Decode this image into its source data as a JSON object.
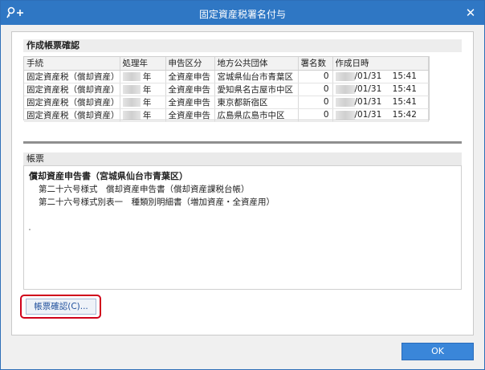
{
  "window": {
    "title": "固定資産税署名付与",
    "close_glyph": "✕",
    "app_icon": "key-plus-icon"
  },
  "section_confirm": {
    "header": "作成帳票確認"
  },
  "table": {
    "columns": [
      "手続",
      "処理年",
      "申告区分",
      "地方公共団体",
      "署名数",
      "作成日時"
    ],
    "rows": [
      {
        "procedure": "固定資産税（償却資産）",
        "year_suffix": "年",
        "category": "全資産申告",
        "municipality": "宮城県仙台市青葉区",
        "count": "0",
        "date": "/01/31",
        "time": "15:41"
      },
      {
        "procedure": "固定資産税（償却資産）",
        "year_suffix": "年",
        "category": "全資産申告",
        "municipality": "愛知県名古屋市中区",
        "count": "0",
        "date": "/01/31",
        "time": "15:41"
      },
      {
        "procedure": "固定資産税（償却資産）",
        "year_suffix": "年",
        "category": "全資産申告",
        "municipality": "東京都新宿区",
        "count": "0",
        "date": "/01/31",
        "time": "15:41"
      },
      {
        "procedure": "固定資産税（償却資産）",
        "year_suffix": "年",
        "category": "全資産申告",
        "municipality": "広島県広島市中区",
        "count": "0",
        "date": "/01/31",
        "time": "15:42"
      }
    ]
  },
  "section_report": {
    "header": "帳票",
    "main": "償却資産申告書（宮城県仙台市青葉区）",
    "items": [
      "第二十六号様式　償却資産申告書（償却資産課税台帳）",
      "第二十六号様式別表一　種類別明細書（増加資産・全資産用）"
    ]
  },
  "buttons": {
    "report_confirm": "帳票確認(C)...",
    "ok": "OK"
  }
}
